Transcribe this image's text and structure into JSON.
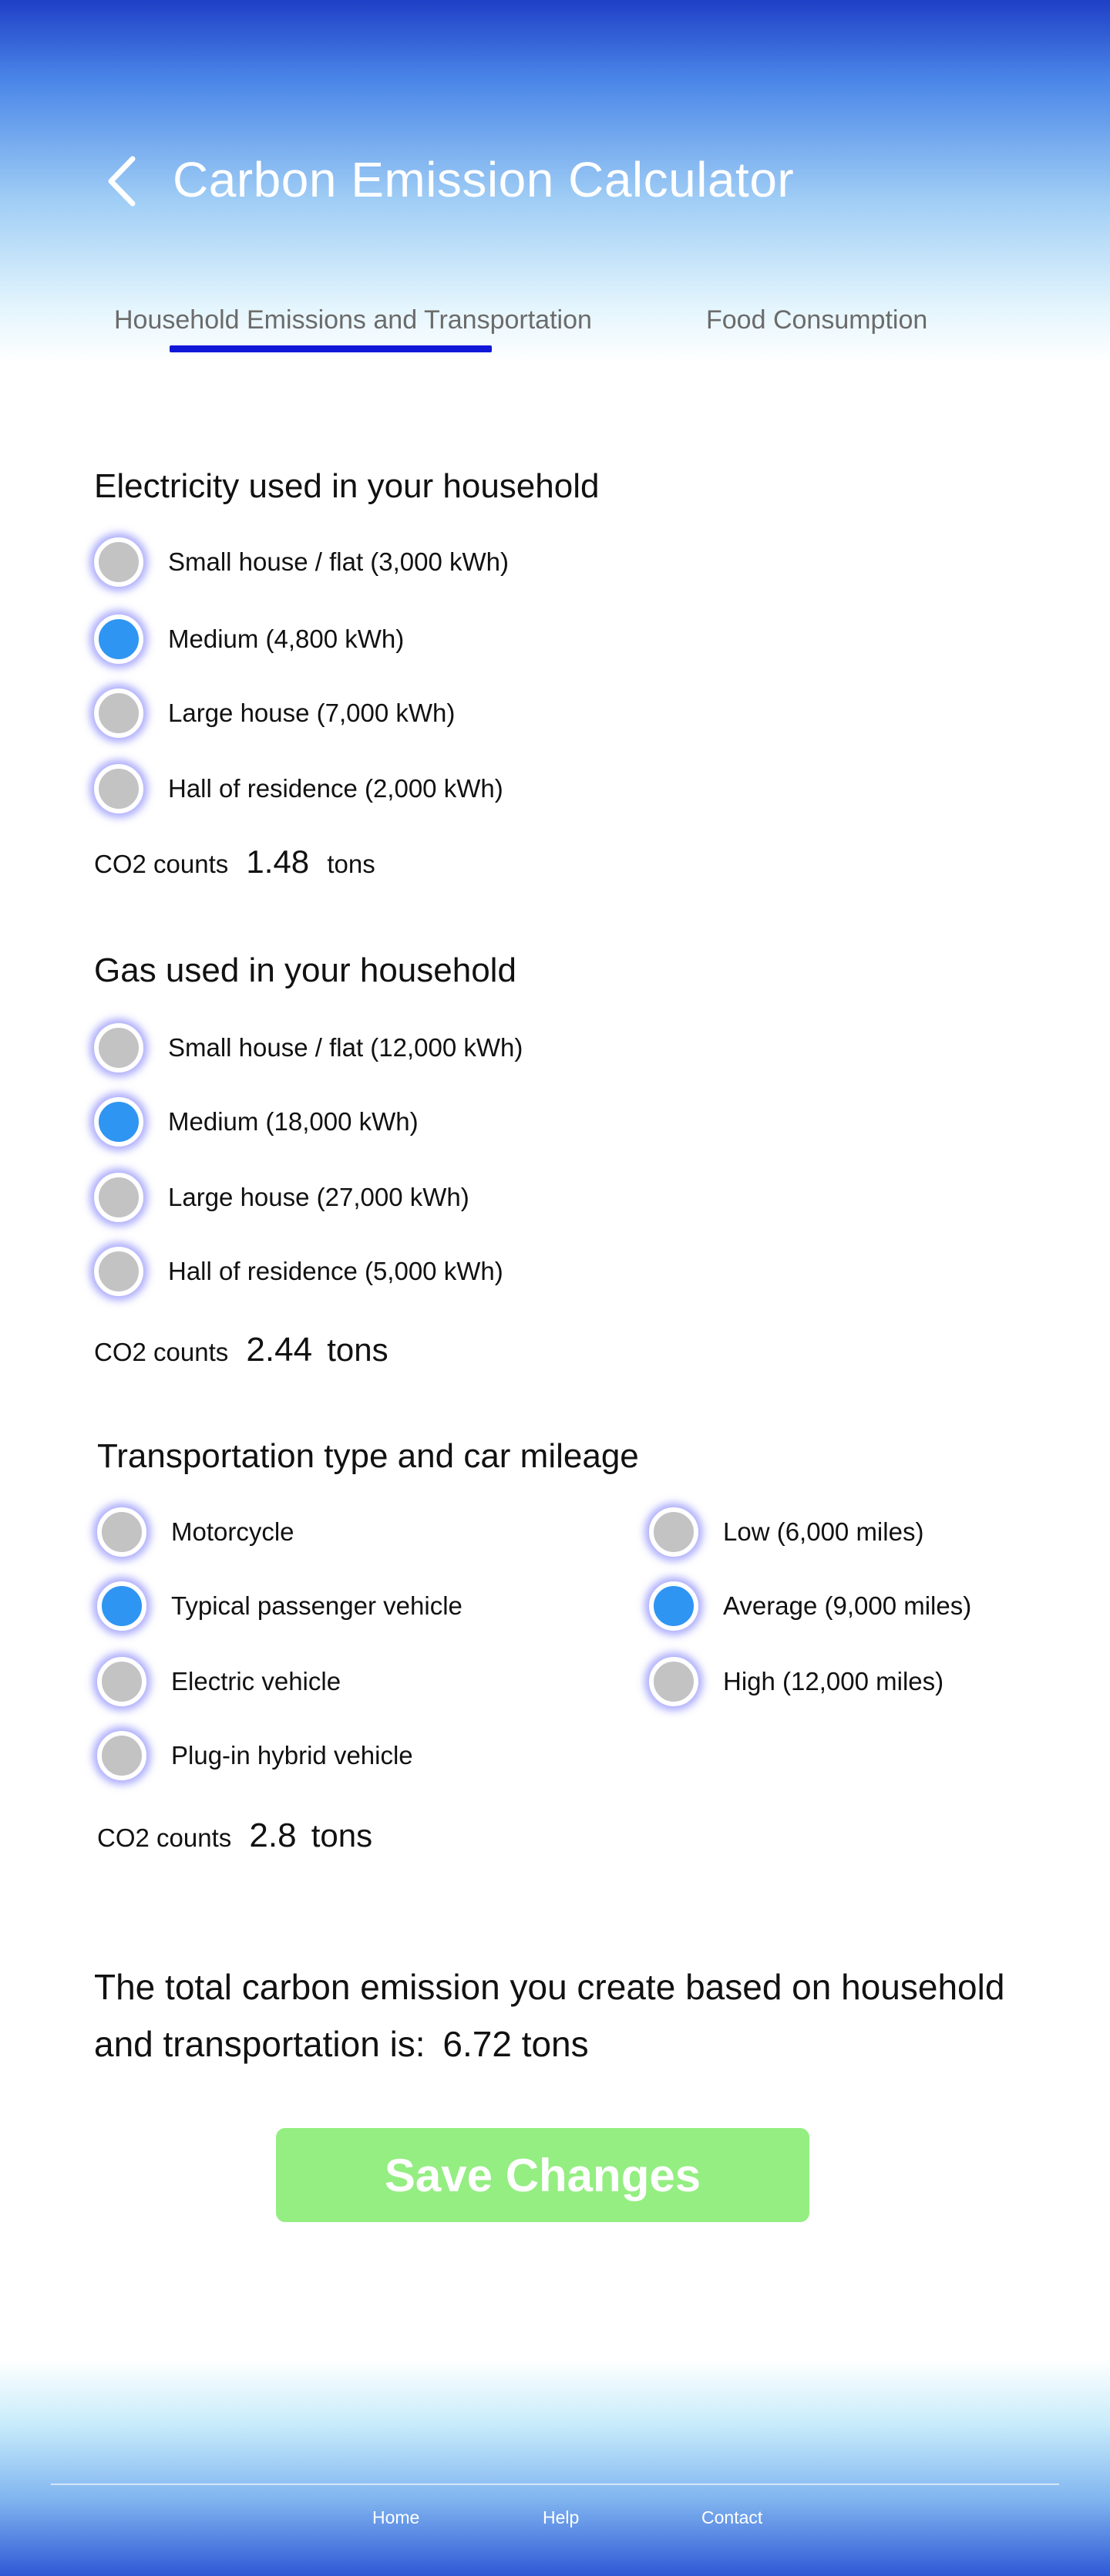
{
  "header": {
    "title": "Carbon Emission Calculator",
    "back_icon": "chevron-left-icon"
  },
  "tabs": [
    {
      "label": "Household Emissions and Transportation",
      "active": true
    },
    {
      "label": "Food Consumption",
      "active": false
    }
  ],
  "electricity": {
    "title": "Electricity used in your household",
    "options": [
      {
        "label": "Small house / flat (3,000 kWh)",
        "selected": false
      },
      {
        "label": "Medium (4,800 kWh)",
        "selected": true
      },
      {
        "label": "Large house (7,000 kWh)",
        "selected": false
      },
      {
        "label": "Hall of residence (2,000 kWh)",
        "selected": false
      }
    ],
    "co2_label": "CO2 counts",
    "co2_value": "1.48",
    "co2_unit": "tons"
  },
  "gas": {
    "title": "Gas used in your household",
    "options": [
      {
        "label": "Small house / flat (12,000 kWh)",
        "selected": false
      },
      {
        "label": "Medium (18,000 kWh)",
        "selected": true
      },
      {
        "label": "Large house (27,000 kWh)",
        "selected": false
      },
      {
        "label": "Hall of residence (5,000 kWh)",
        "selected": false
      }
    ],
    "co2_label": "CO2 counts",
    "co2_value": "2.44",
    "co2_unit": "tons"
  },
  "transport": {
    "title": "Transportation type and car mileage",
    "types": [
      {
        "label": "Motorcycle",
        "selected": false
      },
      {
        "label": "Typical passenger vehicle",
        "selected": true
      },
      {
        "label": "Electric vehicle",
        "selected": false
      },
      {
        "label": "Plug-in hybrid vehicle",
        "selected": false
      }
    ],
    "mileage": [
      {
        "label": "Low (6,000 miles)",
        "selected": false
      },
      {
        "label": "Average (9,000 miles)",
        "selected": true
      },
      {
        "label": "High (12,000 miles)",
        "selected": false
      }
    ],
    "co2_label": "CO2 counts",
    "co2_value": "2.8",
    "co2_unit": "tons"
  },
  "total": {
    "text": "The total carbon emission you create based on household and transportation is:",
    "value": "6.72",
    "unit": "tons"
  },
  "save_label": "Save Changes",
  "footer": {
    "links": [
      "Home",
      "Help",
      "Contact"
    ]
  },
  "colors": {
    "radio_selected": "#2f95f2",
    "radio_unselected": "#c3c3c3",
    "tab_underline": "#1018d8",
    "save_button": "#94ee82"
  }
}
